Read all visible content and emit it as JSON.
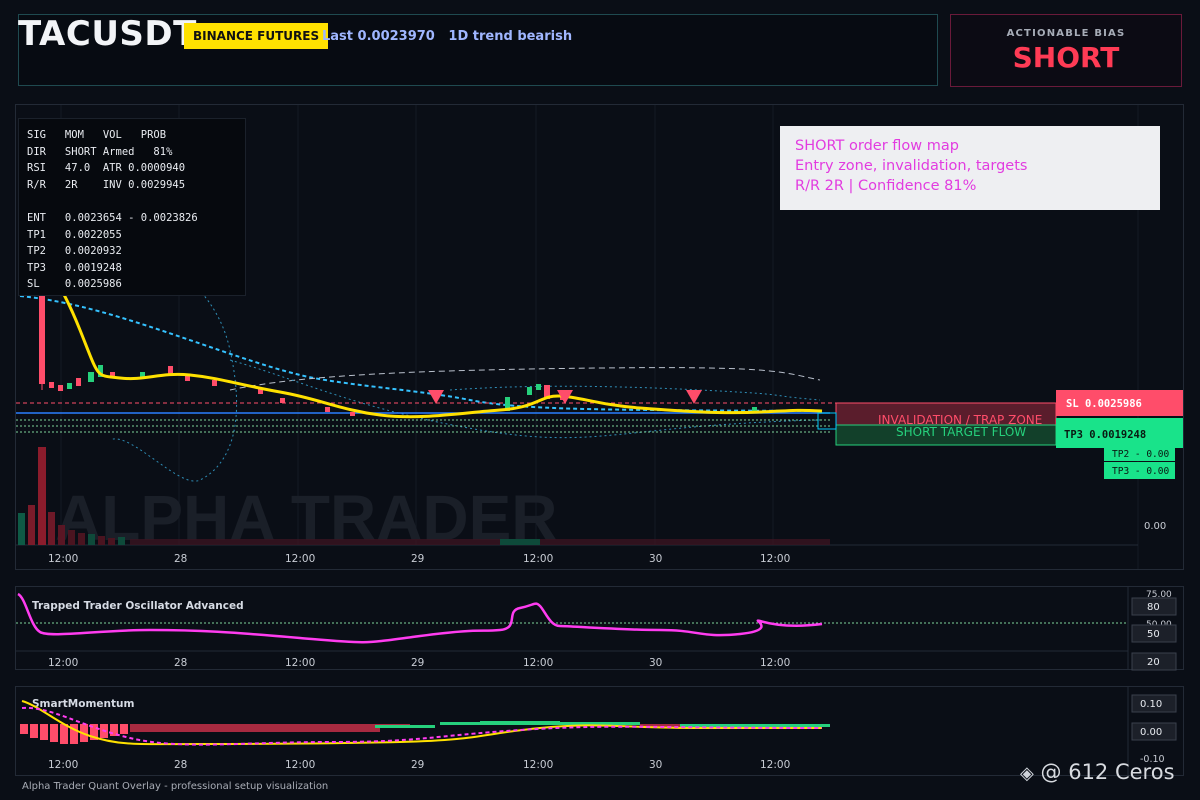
{
  "header": {
    "symbol": "TACUSDT",
    "exchange_badge": "BINANCE FUTURES",
    "last": "Last 0.0023970",
    "trend": "1D trend bearish"
  },
  "bias": {
    "label": "ACTIONABLE BIAS",
    "value": "SHORT"
  },
  "stats_panel": {
    "lines": [
      "SIG   MOM   VOL   PROB",
      "DIR   SHORT Armed   81%",
      "RSI   47.0  ATR 0.0000940",
      "R/R   2R    INV 0.0029945",
      "",
      "ENT   0.0023654 - 0.0023826",
      "TP1   0.0022055",
      "TP2   0.0020932",
      "TP3   0.0019248",
      "SL    0.0025986"
    ]
  },
  "info_box": {
    "line1": "SHORT order flow map",
    "line2": "Entry zone, invalidation, targets",
    "line3": "R/R 2R | Confidence 81%"
  },
  "main_chart": {
    "watermark": "ALPHA TRADER",
    "zone_invalidation": "INVALIDATION / TRAP ZONE",
    "zone_target": "SHORT TARGET FLOW",
    "sl_tag": "SL  0.0025986",
    "tp3_tag": "TP3 0.0019248",
    "tp2_small": "TP2 - 0.00",
    "tp3_small": "TP3 - 0.00",
    "y_zero": "0.00",
    "x_ticks": [
      "12:00",
      "28",
      "12:00",
      "29",
      "12:00",
      "30",
      "12:00"
    ],
    "colors": {
      "up": "#26d07c",
      "down": "#ff4d6a",
      "ema": "#ffe100",
      "accent": "#00c8ff"
    }
  },
  "oscillator": {
    "title": "Trapped Trader Oscillator Advanced",
    "y_labels": [
      "75.00",
      "80",
      "50.00",
      "50",
      "20"
    ],
    "x_ticks": [
      "12:00",
      "28",
      "12:00",
      "29",
      "12:00",
      "30",
      "12:00"
    ],
    "color": "#ff3cf0"
  },
  "momentum": {
    "title": "SmartMomentum",
    "y_labels": [
      "0.10",
      "0.00",
      "-0.10"
    ],
    "x_ticks": [
      "12:00",
      "28",
      "12:00",
      "29",
      "12:00",
      "30",
      "12:00"
    ]
  },
  "footer": "Alpha Trader Quant Overlay - professional setup visualization",
  "watermark_account": "@ 612 Ceros",
  "chart_data": {
    "type": "line",
    "title": "",
    "x": [
      "12:00",
      "28",
      "12:00",
      "29",
      "12:00",
      "30",
      "12:00"
    ],
    "series": [
      {
        "name": "",
        "values": [
          0.00265,
          0.00241,
          0.00239,
          0.00239,
          0.00242,
          0.0024,
          0.00239
        ]
      }
    ],
    "levels": {
      "SL": 0.0025986,
      "TP1": 0.0022055,
      "TP2": 0.0020932,
      "TP3": 0.0019248,
      "ENT_low": 0.0023654,
      "ENT_high": 0.0023826
    }
  }
}
